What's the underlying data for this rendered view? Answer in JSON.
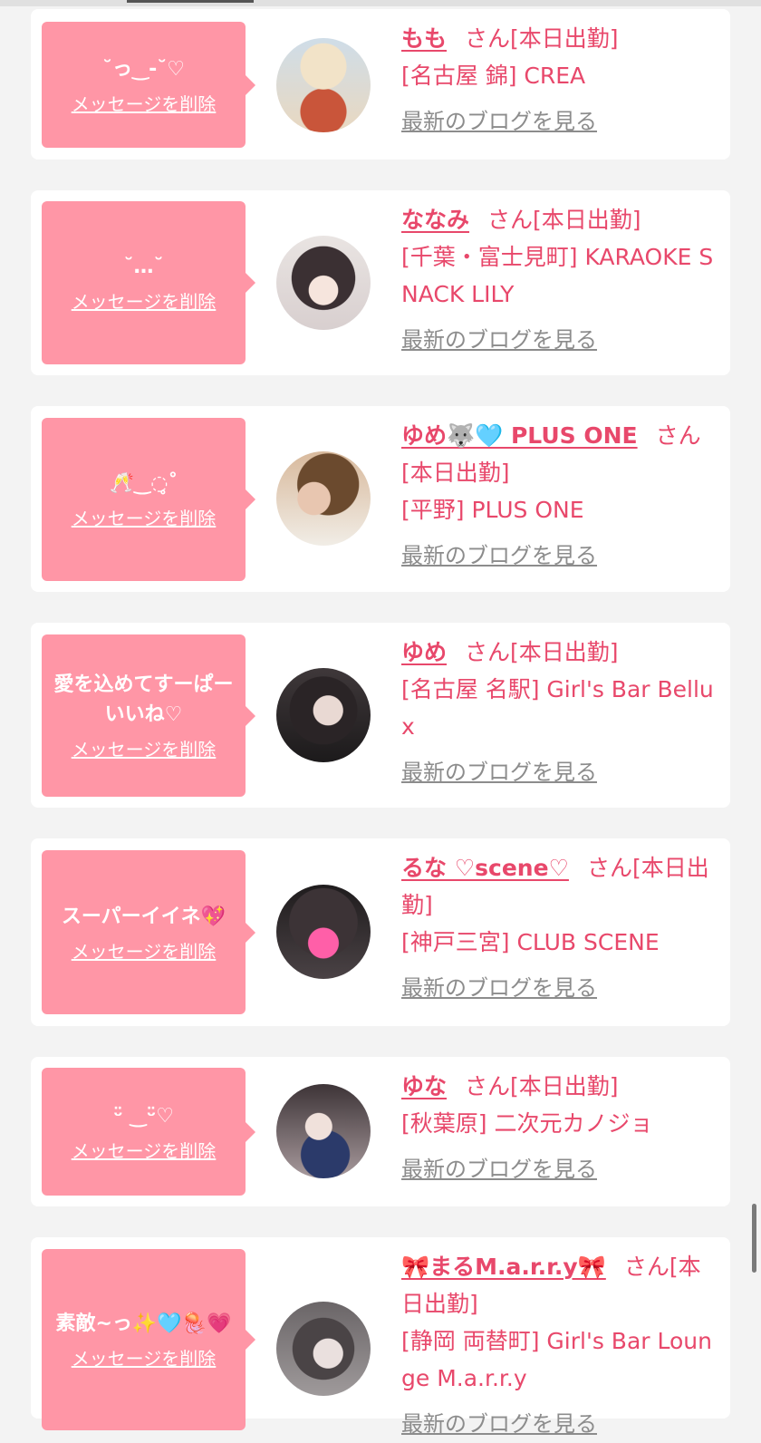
{
  "delete_label": "メッセージを削除",
  "blog_label": "最新のブログを見る",
  "colors": {
    "accent": "#e8486b",
    "bubble": "#ff96a6",
    "background": "#f3f3f3",
    "link_gray": "#8c8c8c"
  },
  "cards": [
    {
      "message": "˘っ‿‐˘♡",
      "name": "もも",
      "san": "さん",
      "status": "[本日出勤]",
      "area": "[名古屋 錦]",
      "shop": "CREA",
      "avatar_icon": "food-photo-icon"
    },
    {
      "message": "˘…˘",
      "name": "ななみ",
      "san": "さん",
      "status": "[本日出勤]",
      "area": "[千葉・富士見町]",
      "shop": "KARAOKE SNACK LILY",
      "avatar_icon": "girl-photo-icon"
    },
    {
      "message": "🥂‿◌̥˚",
      "name": "ゆめ🐺🩵 PLUS ONE",
      "san": "さん",
      "status": "[本日出勤]",
      "area": "[平野]",
      "shop": "PLUS ONE",
      "avatar_icon": "girl-photo-icon"
    },
    {
      "message": "愛を込めてすーぱーいいね♡",
      "name": "ゆめ",
      "san": "さん",
      "status": "[本日出勤]",
      "area": "[名古屋 名駅]",
      "shop": "Girl's Bar Bellux",
      "avatar_icon": "girl-photo-icon"
    },
    {
      "message": "スーパーイイネ💖",
      "name": "るな ♡scene♡",
      "san": "さん",
      "status": "[本日出勤]",
      "area": "[神戸三宮]",
      "shop": "CLUB SCENE",
      "avatar_icon": "heart-sticker-photo-icon"
    },
    {
      "message": "ᵕ̈  ‿ᵕ̈♡",
      "name": "ゆな",
      "san": "さん",
      "status": "[本日出勤]",
      "area": "[秋葉原]",
      "shop": "二次元カノジョ",
      "avatar_icon": "girl-photo-icon"
    },
    {
      "message": "素敵~っ✨🩵🪼💗",
      "name": "🎀まるM.a.r.r.y🎀",
      "san": "さん",
      "status": "[本日出勤]",
      "area": "[静岡 両替町]",
      "shop": "Girl's Bar Lounge M.a.r.r.y",
      "avatar_icon": "girl-photo-icon"
    }
  ]
}
